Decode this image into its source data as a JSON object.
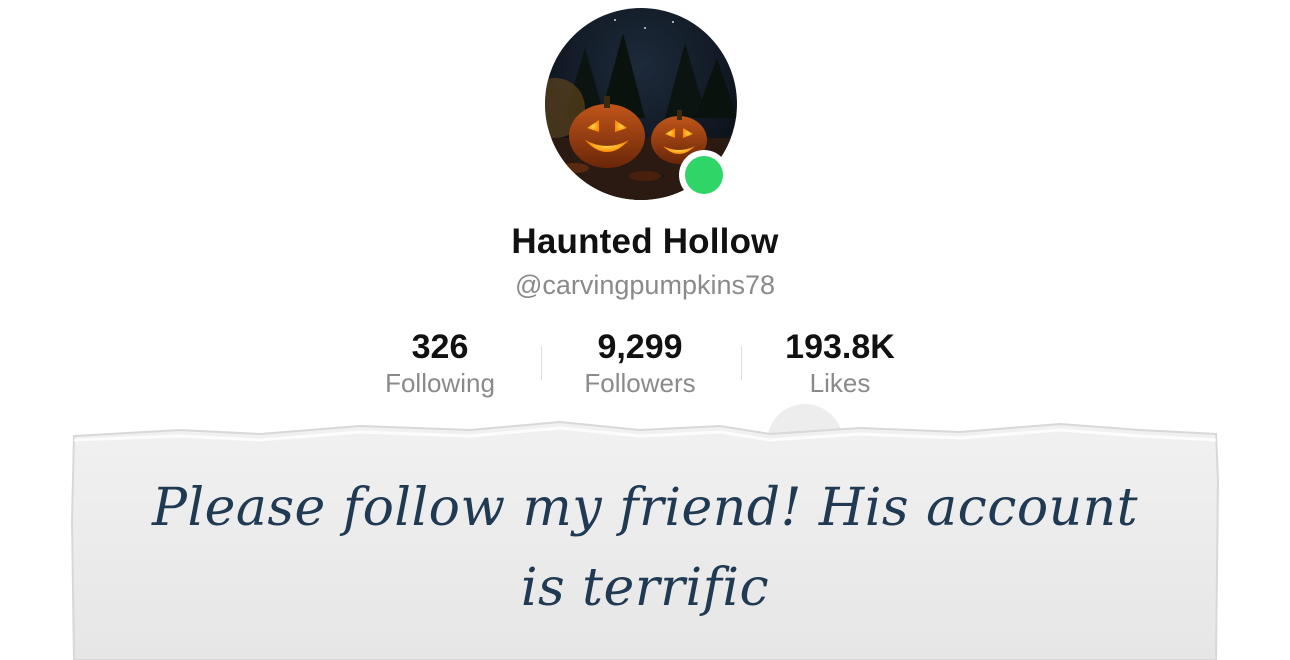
{
  "profile": {
    "display_name": "Haunted Hollow",
    "handle": "@carvingpumpkins78",
    "avatar_icon": "pumpkin-avatar",
    "online_status_color": "#2fd566"
  },
  "stats": [
    {
      "value": "326",
      "label": "Following"
    },
    {
      "value": "9,299",
      "label": "Followers"
    },
    {
      "value": "193.8K",
      "label": "Likes"
    }
  ],
  "note": {
    "line1": "Please follow my friend!  His account",
    "line2": "is terrific",
    "text_color": "#1f3a52"
  }
}
